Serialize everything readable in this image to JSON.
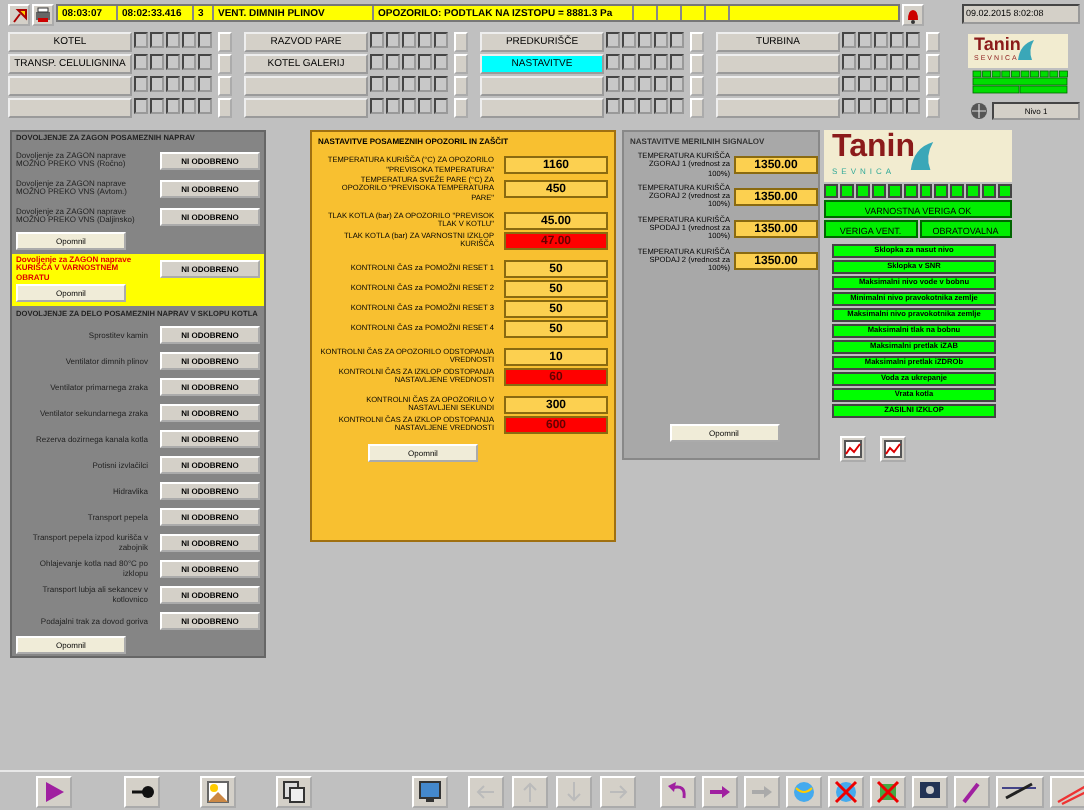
{
  "alarm_bar": {
    "cells": [
      "08:03:07",
      "08:02:33.416",
      "3",
      "VENT. DIMNIH PLINOV",
      "OPOZORILO: PODTLAK NA IZSTOPU = 8881.3 Pa"
    ],
    "date": "09.02.2015 8:02:08"
  },
  "area_grid": [
    [
      {
        "label": "KOTEL",
        "selected": false
      },
      {
        "label": "RAZVOD PARE",
        "selected": false
      },
      {
        "label": "PREDKURIŠČE",
        "selected": false
      },
      {
        "label": "TURBINA",
        "selected": false
      }
    ],
    [
      {
        "label": "TRANSP. CELULIGNINA",
        "selected": false
      },
      {
        "label": "KOTEL GALERIJ",
        "selected": false
      },
      {
        "label": "NASTAVITVE",
        "selected": true
      },
      {
        "selected": false
      }
    ],
    [
      {
        "selected": false
      },
      {
        "selected": false
      },
      {
        "selected": false
      },
      {
        "selected": false
      }
    ],
    [
      {
        "selected": false
      },
      {
        "selected": false
      },
      {
        "selected": false
      },
      {
        "selected": false
      }
    ]
  ],
  "user_level": "Nivo 1",
  "logo_small": {
    "name": "Tanin",
    "sub": "SEVNICA"
  },
  "logo": {
    "name": "Tanin",
    "sub": "SEVNICA"
  },
  "permits": {
    "title": "DOVOLJENJE ZA ZAGON POSAMEZNIH NAPRAV",
    "rows": [
      {
        "label": "Dovoljenje za ZAGON naprave MOŽNO PREKO VNS (Ročno)",
        "button": "NI ODOBRENO"
      },
      {
        "label": "Dovoljenje za ZAGON naprave MOŽNO PREKO VNS (Avtom.)",
        "button": "NI ODOBRENO"
      },
      {
        "label": "Dovoljenje za ZAGON naprave MOŽNO PREKO VNS (Daljinsko)",
        "button": "NI ODOBRENO"
      }
    ],
    "confirm": "Opomnil",
    "highlight": {
      "label": "Dovoljenje za ZAGON naprave KURIŠČA V VARNOSTNEM OBRATU",
      "button": "NI ODOBRENO",
      "confirm": "Opomnil"
    },
    "title2": "DOVOLJENJE ZA DELO POSAMEZNIH NAPRAV V SKLOPU KOTLA",
    "devices": [
      {
        "label": "Sprostitev kamin",
        "button": "NI ODOBRENO"
      },
      {
        "label": "Ventilator dimnih plinov",
        "button": "NI ODOBRENO"
      },
      {
        "label": "Ventilator primarnega zraka",
        "button": "NI ODOBRENO"
      },
      {
        "label": "Ventilator sekundarnega zraka",
        "button": "NI ODOBRENO"
      },
      {
        "label": "Rezerva dozirnega kanala kotla",
        "button": "NI ODOBRENO"
      },
      {
        "label": "Potisni izvlačilci",
        "button": "NI ODOBRENO"
      },
      {
        "label": "Hidravlika",
        "button": "NI ODOBRENO"
      },
      {
        "label": "Transport pepela",
        "button": "NI ODOBRENO"
      },
      {
        "label": "Transport pepela izpod kurišča v zabojnik",
        "button": "NI ODOBRENO"
      },
      {
        "label": "Ohlajevanje kotla nad 80°C po izklopu",
        "button": "NI ODOBRENO"
      },
      {
        "label": "Transport lubja ali sekancev v kotlovnico",
        "button": "NI ODOBRENO"
      },
      {
        "label": "Podajalni trak za dovod goriva",
        "button": "NI ODOBRENO"
      }
    ],
    "confirm2": "Opomnil"
  },
  "alarm_settings": {
    "title": "NASTAVITVE POSAMEZNIH OPOZORIL IN ZAŠČIT",
    "groups": [
      [
        {
          "label": "TEMPERATURA KURIŠČA (°C) ZA OPOZORILO \"PREVISOKA TEMPERATURA\"",
          "value": "1160",
          "alarm": false
        },
        {
          "label": "TEMPERATURA SVEŽE PARE (°C) ZA OPOZORILO \"PREVISOKA TEMPERATURA PARE\"",
          "value": "450",
          "alarm": false
        }
      ],
      [
        {
          "label": "TLAK KOTLA (bar) ZA OPOZORILO \"PREVISOK TLAK V KOTLU\"",
          "value": "45.00",
          "alarm": false
        },
        {
          "label": "TLAK KOTLA (bar) ZA VARNOSTNI IZKLOP KURIŠČA",
          "value": "47.00",
          "alarm": true
        }
      ],
      [
        {
          "label": "KONTROLNI ČAS za POMOŽNI RESET 1",
          "value": "50",
          "alarm": false
        },
        {
          "label": "KONTROLNI ČAS za POMOŽNI RESET 2",
          "value": "50",
          "alarm": false
        },
        {
          "label": "KONTROLNI ČAS za POMOŽNI RESET 3",
          "value": "50",
          "alarm": false
        },
        {
          "label": "KONTROLNI ČAS za POMOŽNI RESET 4",
          "value": "50",
          "alarm": false
        }
      ],
      [
        {
          "label": "KONTROLNI ČAS ZA OPOZORILO ODSTOPANJA VREDNOSTI",
          "value": "10",
          "alarm": false
        },
        {
          "label": "KONTROLNI ČAS ZA IZKLOP ODSTOPANJA NASTAVLJENE VREDNOSTI",
          "value": "60",
          "alarm": true
        }
      ],
      [
        {
          "label": "KONTROLNI ČAS ZA OPOZORILO V NASTAVLJENI SEKUNDI",
          "value": "300",
          "alarm": false
        },
        {
          "label": "KONTROLNI ČAS ZA IZKLOP ODSTOPANJA NASTAVLJENE VREDNOSTI",
          "value": "600",
          "alarm": true
        }
      ]
    ],
    "confirm": "Opomnil"
  },
  "signals": {
    "title": "NASTAVITVE MERILNIH SIGNALOV",
    "rows": [
      {
        "label": "TEMPERATURA KURIŠČA ZGORAJ 1 (vrednost za 100%)",
        "value": "1350.00"
      },
      {
        "label": "TEMPERATURA KURIŠČA ZGORAJ 2 (vrednost za 100%)",
        "value": "1350.00"
      },
      {
        "label": "TEMPERATURA KURIŠČA SPODAJ 1 (vrednost za 100%)",
        "value": "1350.00"
      },
      {
        "label": "TEMPERATURA KURIŠČA SPODAJ 2 (vrednost za 100%)",
        "value": "1350.00"
      }
    ],
    "confirm": "Opomnil"
  },
  "safety": {
    "lamps": [
      {
        "on": true
      },
      {
        "on": true
      },
      {
        "on": true
      },
      {
        "on": true
      },
      {
        "on": true
      },
      {
        "on": true
      },
      {
        "on": true
      },
      {
        "on": true
      },
      {
        "on": true
      },
      {
        "on": true
      },
      {
        "on": true
      },
      {
        "on": true
      }
    ],
    "chain": {
      "label": "VARNOSTNA VERIGA OK",
      "on": true
    },
    "parts": [
      {
        "label": "VERIGA VENT.",
        "on": true
      },
      {
        "label": "OBRATOVALNA",
        "on": true
      }
    ]
  },
  "interlocks": [
    {
      "label": "Sklopka za nasut nivo",
      "on": true
    },
    {
      "label": "Sklopka v SNR",
      "on": true
    },
    {
      "label": "Maksimalni nivo vode v bobnu",
      "on": true
    },
    {
      "label": "Minimalni nivo pravokotnika zemlje",
      "on": true
    },
    {
      "label": "Maksimalni nivo pravokotnika zemlje",
      "on": true
    },
    {
      "label": "Maksimalni tlak na bobnu",
      "on": true
    },
    {
      "label": "Maksimalni pretlak iZAB",
      "on": true
    },
    {
      "label": "Maksimalni pretlak iZDROb",
      "on": true
    },
    {
      "label": "Voda za ukrepanje",
      "on": true
    },
    {
      "label": "Vrata kotla",
      "on": true
    },
    {
      "label": "ZASILNI IZKLOP",
      "on": true
    }
  ]
}
